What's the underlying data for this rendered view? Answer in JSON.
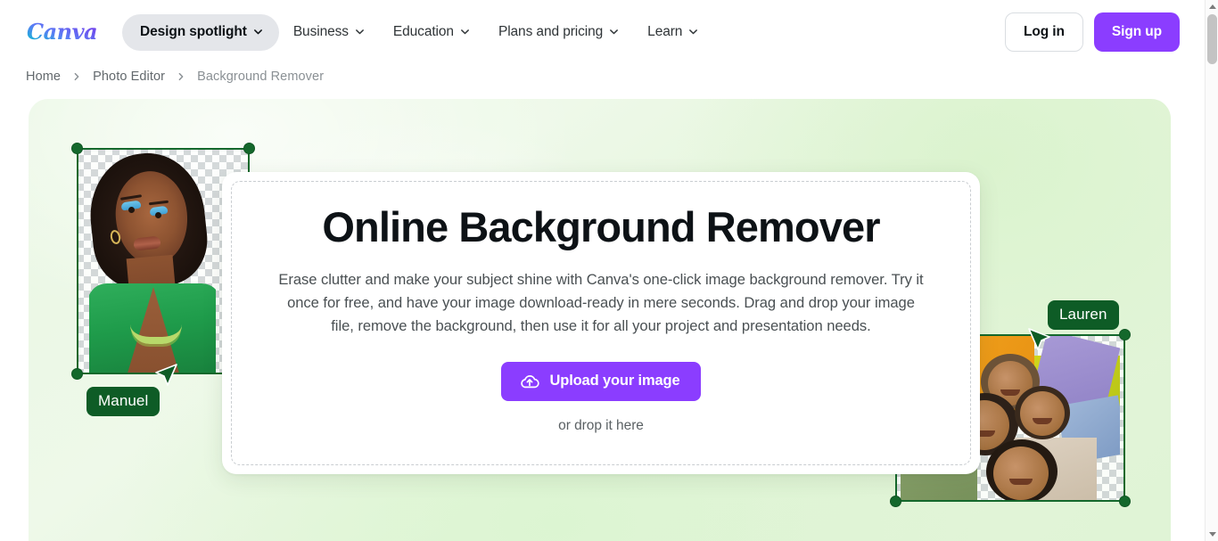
{
  "brand": {
    "logo_text": "Canva",
    "accent_purple": "#8b3dff",
    "frame_green": "#14682c",
    "tag_green": "#0e5c26"
  },
  "header": {
    "spotlight": {
      "label": "Design spotlight",
      "icon": "chevron-down-icon"
    },
    "nav": [
      {
        "label": "Business",
        "icon": "chevron-down-icon"
      },
      {
        "label": "Education",
        "icon": "chevron-down-icon"
      },
      {
        "label": "Plans and pricing",
        "icon": "chevron-down-icon"
      },
      {
        "label": "Learn",
        "icon": "chevron-down-icon"
      }
    ],
    "login_label": "Log in",
    "signup_label": "Sign up"
  },
  "breadcrumb": {
    "separator": "chevron-right-icon",
    "items": [
      {
        "label": "Home"
      },
      {
        "label": "Photo Editor"
      },
      {
        "label": "Background Remover"
      }
    ]
  },
  "hero": {
    "title": "Online Background Remover",
    "description": "Erase clutter and make your subject shine with Canva's one-click image background remover. Try it once for free, and have your image download-ready in mere seconds. Drag and drop your image file, remove the background, then use it for all your project and presentation needs.",
    "upload_button": {
      "label": "Upload your image",
      "icon": "cloud-upload-icon"
    },
    "drop_hint": "or drop it here"
  },
  "collaborators": [
    {
      "name": "Manuel",
      "side": "left"
    },
    {
      "name": "Lauren",
      "side": "right"
    }
  ],
  "scrollbar": {
    "up_icon": "triangle-up-icon",
    "down_icon": "triangle-down-icon"
  }
}
